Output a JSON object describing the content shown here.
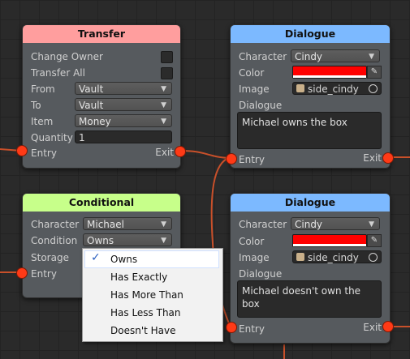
{
  "colors": {
    "transfer_header": "#ff9e9e",
    "dialogue_header": "#7cb9ff",
    "conditional_header": "#c7ff8a",
    "port": "#ff3a16",
    "wire": "#c8502a"
  },
  "transfer": {
    "title": "Transfer",
    "change_owner_label": "Change Owner",
    "transfer_all_label": "Transfer All",
    "from_label": "From",
    "from_value": "Vault",
    "to_label": "To",
    "to_value": "Vault",
    "item_label": "Item",
    "item_value": "Money",
    "quantity_label": "Quantity",
    "quantity_value": "1",
    "entry_label": "Entry",
    "exit_label": "Exit"
  },
  "dialogue1": {
    "title": "Dialogue",
    "character_label": "Character",
    "character_value": "Cindy",
    "color_label": "Color",
    "image_label": "Image",
    "image_value": "side_cindy",
    "dialogue_label": "Dialogue",
    "dialogue_text": "Michael owns the box",
    "entry_label": "Entry",
    "exit_label": "Exit"
  },
  "conditional": {
    "title": "Conditional",
    "character_label": "Character",
    "character_value": "Michael",
    "condition_label": "Condition",
    "condition_value": "Owns",
    "storage_label": "Storage",
    "entry_label": "Entry"
  },
  "dialogue2": {
    "title": "Dialogue",
    "character_label": "Character",
    "character_value": "Cindy",
    "color_label": "Color",
    "image_label": "Image",
    "image_value": "side_cindy",
    "dialogue_label": "Dialogue",
    "dialogue_text": "Michael doesn't own the box",
    "entry_label": "Entry",
    "exit_label": "Exit"
  },
  "condition_menu": {
    "selected": "Owns",
    "items": [
      "Owns",
      "Has Exactly",
      "Has More Than",
      "Has Less Than",
      "Doesn't Have"
    ]
  }
}
